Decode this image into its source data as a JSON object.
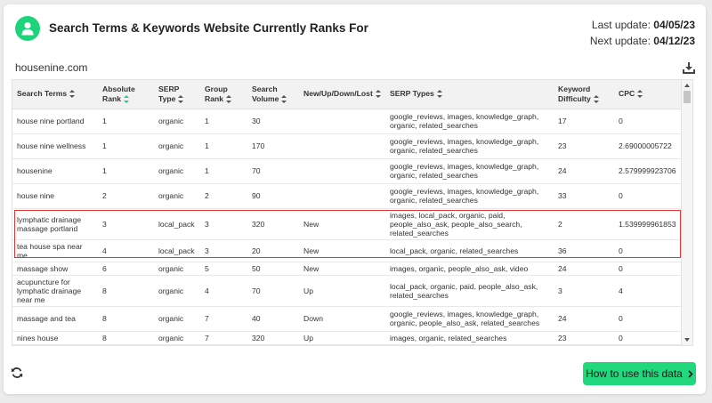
{
  "header": {
    "title": "Search Terms & Keywords Website Currently Ranks For",
    "last_update_label": "Last update: ",
    "last_update_value": "04/05/23",
    "next_update_label": "Next update: ",
    "next_update_value": "04/12/23",
    "accent_color": "#1ed47a"
  },
  "domain": "housenine.com",
  "table": {
    "headers": [
      "Search Terms",
      "Absolute Rank",
      "SERP Type",
      "Group Rank",
      "Search Volume",
      "New/Up/Down/Lost",
      "SERP Types",
      "Keyword Difficulty",
      "CPC"
    ],
    "rows": [
      [
        "house nine portland",
        "1",
        "organic",
        "1",
        "30",
        "",
        "google_reviews, images, knowledge_graph, organic, related_searches",
        "17",
        "0"
      ],
      [
        "house nine wellness",
        "1",
        "organic",
        "1",
        "170",
        "",
        "google_reviews, images, knowledge_graph, organic, related_searches",
        "23",
        "2.69000005722"
      ],
      [
        "housenine",
        "1",
        "organic",
        "1",
        "70",
        "",
        "google_reviews, images, knowledge_graph, organic, related_searches",
        "24",
        "2.579999923706"
      ],
      [
        "house nine",
        "2",
        "organic",
        "2",
        "90",
        "",
        "google_reviews, images, knowledge_graph, organic, related_searches",
        "33",
        "0"
      ],
      [
        "lymphatic drainage massage portland",
        "3",
        "local_pack",
        "3",
        "320",
        "New",
        "images, local_pack, organic, paid, people_also_ask, people_also_search, related_searches",
        "2",
        "1.539999961853"
      ],
      [
        "tea house spa near me",
        "4",
        "local_pack",
        "3",
        "20",
        "New",
        "local_pack, organic, related_searches",
        "36",
        "0"
      ],
      [
        "massage show",
        "6",
        "organic",
        "5",
        "50",
        "New",
        "images, organic, people_also_ask, video",
        "24",
        "0"
      ],
      [
        "acupuncture for lymphatic drainage near me",
        "8",
        "organic",
        "4",
        "70",
        "Up",
        "local_pack, organic, paid, people_also_ask, related_searches",
        "3",
        "4"
      ],
      [
        "massage and tea",
        "8",
        "organic",
        "7",
        "40",
        "Down",
        "google_reviews, images, knowledge_graph, organic, people_also_ask, related_searches",
        "24",
        "0"
      ],
      [
        "nines house",
        "8",
        "organic",
        "7",
        "320",
        "Up",
        "images, organic, related_searches",
        "23",
        "0"
      ],
      [
        "",
        "",
        "",
        "",
        "",
        "",
        "",
        "",
        ""
      ]
    ]
  },
  "footer": {
    "how_to_label": "How to use this data"
  }
}
